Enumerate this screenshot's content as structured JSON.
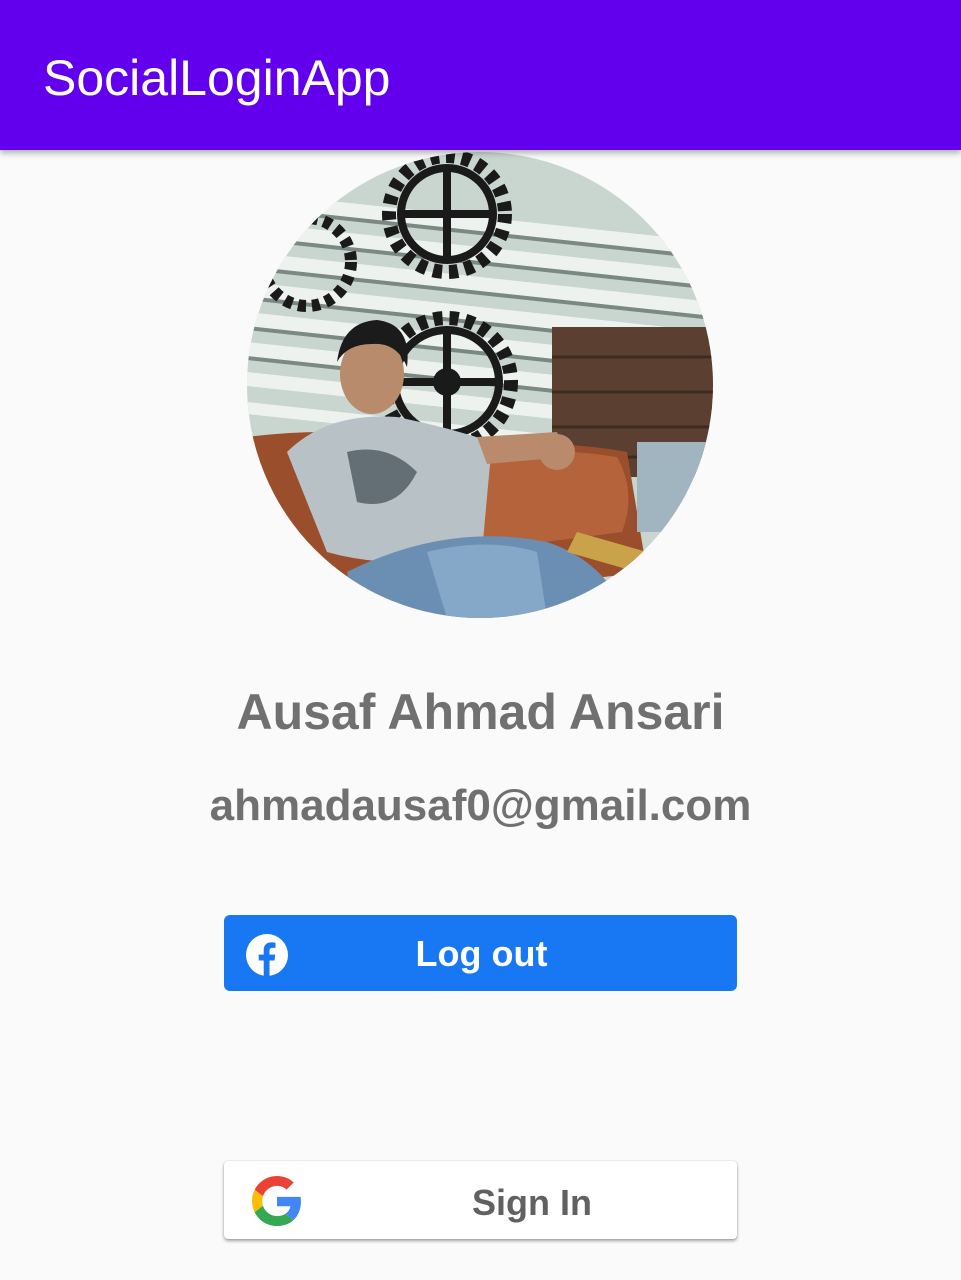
{
  "app_bar": {
    "title": "SocialLoginApp",
    "color": "#6200ee"
  },
  "profile": {
    "photo_icon": "profile-photo",
    "name": "Ausaf Ahmad Ansari",
    "email": "ahmadausaf0@gmail.com"
  },
  "facebook_button": {
    "label": "Log out",
    "icon": "facebook-icon",
    "color": "#1877f2"
  },
  "google_button": {
    "label": "Sign In",
    "icon": "google-icon",
    "color": "#ffffff"
  }
}
